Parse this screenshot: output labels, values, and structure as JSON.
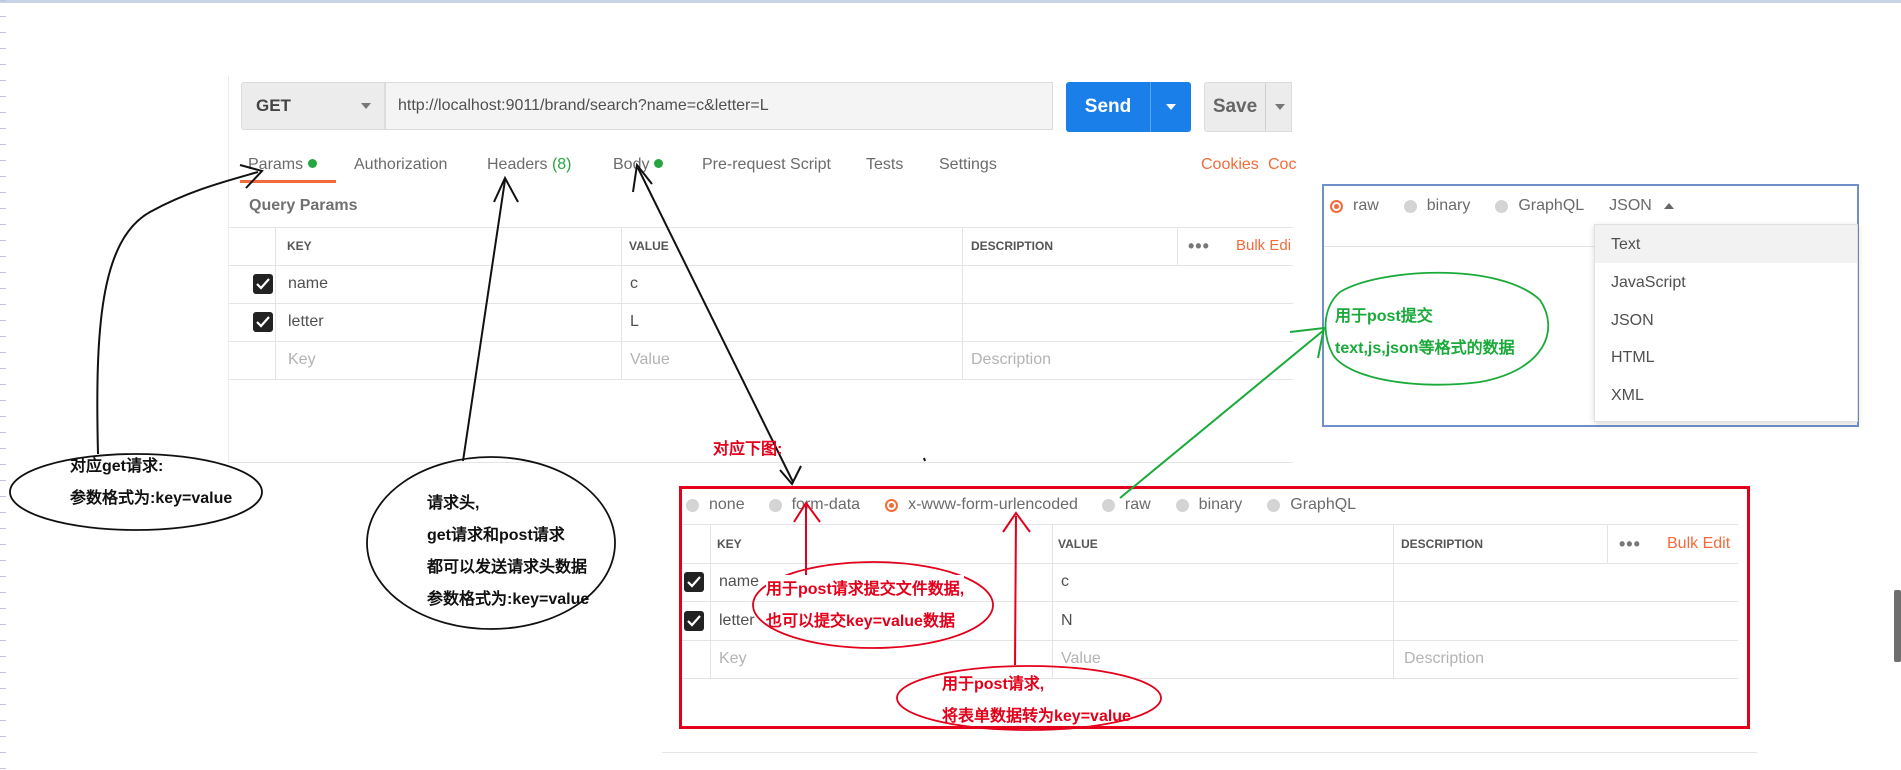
{
  "request": {
    "method": "GET",
    "url": "http://localhost:9011/brand/search?name=c&letter=L",
    "send_label": "Send",
    "save_label": "Save"
  },
  "tabs": [
    {
      "label": "Params"
    },
    {
      "label": "Authorization"
    },
    {
      "label": "Headers",
      "count": "(8)"
    },
    {
      "label": "Body"
    },
    {
      "label": "Pre-request Script"
    },
    {
      "label": "Tests"
    },
    {
      "label": "Settings"
    }
  ],
  "right_links": {
    "cookies": "Cookies",
    "code": "Coc"
  },
  "query_params": {
    "title": "Query Params",
    "headers": {
      "key": "KEY",
      "value": "VALUE",
      "description": "DESCRIPTION",
      "bulk_edit": "Bulk Edi"
    },
    "rows": [
      {
        "key": "name",
        "value": "c"
      },
      {
        "key": "letter",
        "value": "L"
      }
    ],
    "placeholders": {
      "key": "Key",
      "value": "Value",
      "description": "Description"
    }
  },
  "body_panel": {
    "options": [
      "none",
      "form-data",
      "x-www-form-urlencoded",
      "raw",
      "binary",
      "GraphQL"
    ],
    "selected": "x-www-form-urlencoded",
    "headers": {
      "key": "KEY",
      "value": "VALUE",
      "description": "DESCRIPTION",
      "bulk_edit": "Bulk Edit"
    },
    "rows": [
      {
        "key": "name",
        "value": "c"
      },
      {
        "key": "letter",
        "value": "N"
      }
    ],
    "placeholders": {
      "key": "Key",
      "value": "Value",
      "description": "Description"
    }
  },
  "raw_panel": {
    "options": [
      "raw",
      "binary",
      "GraphQL"
    ],
    "format_label": "JSON",
    "dropdown": [
      "Text",
      "JavaScript",
      "JSON",
      "HTML",
      "XML"
    ]
  },
  "annotations": {
    "get_params": [
      "对应get请求:",
      "参数格式为:key=value"
    ],
    "headers": [
      "请求头,",
      "get请求和post请求",
      "都可以发送请求头数据",
      "参数格式为:key=value"
    ],
    "below": "对应下图:",
    "form_data": [
      "用于post请求提交文件数据,",
      "也可以提交key=value数据"
    ],
    "urlencoded": [
      "用于post请求,",
      "将表单数据转为key=value"
    ],
    "raw": [
      "用于post提交",
      "text,js,json等格式的数据"
    ]
  },
  "colors": {
    "accent": "#f26b3a",
    "primary": "#1a7fe8",
    "active_dot": "#26a541",
    "annotation_red": "#e3001b",
    "annotation_green": "#1aaa3a"
  }
}
